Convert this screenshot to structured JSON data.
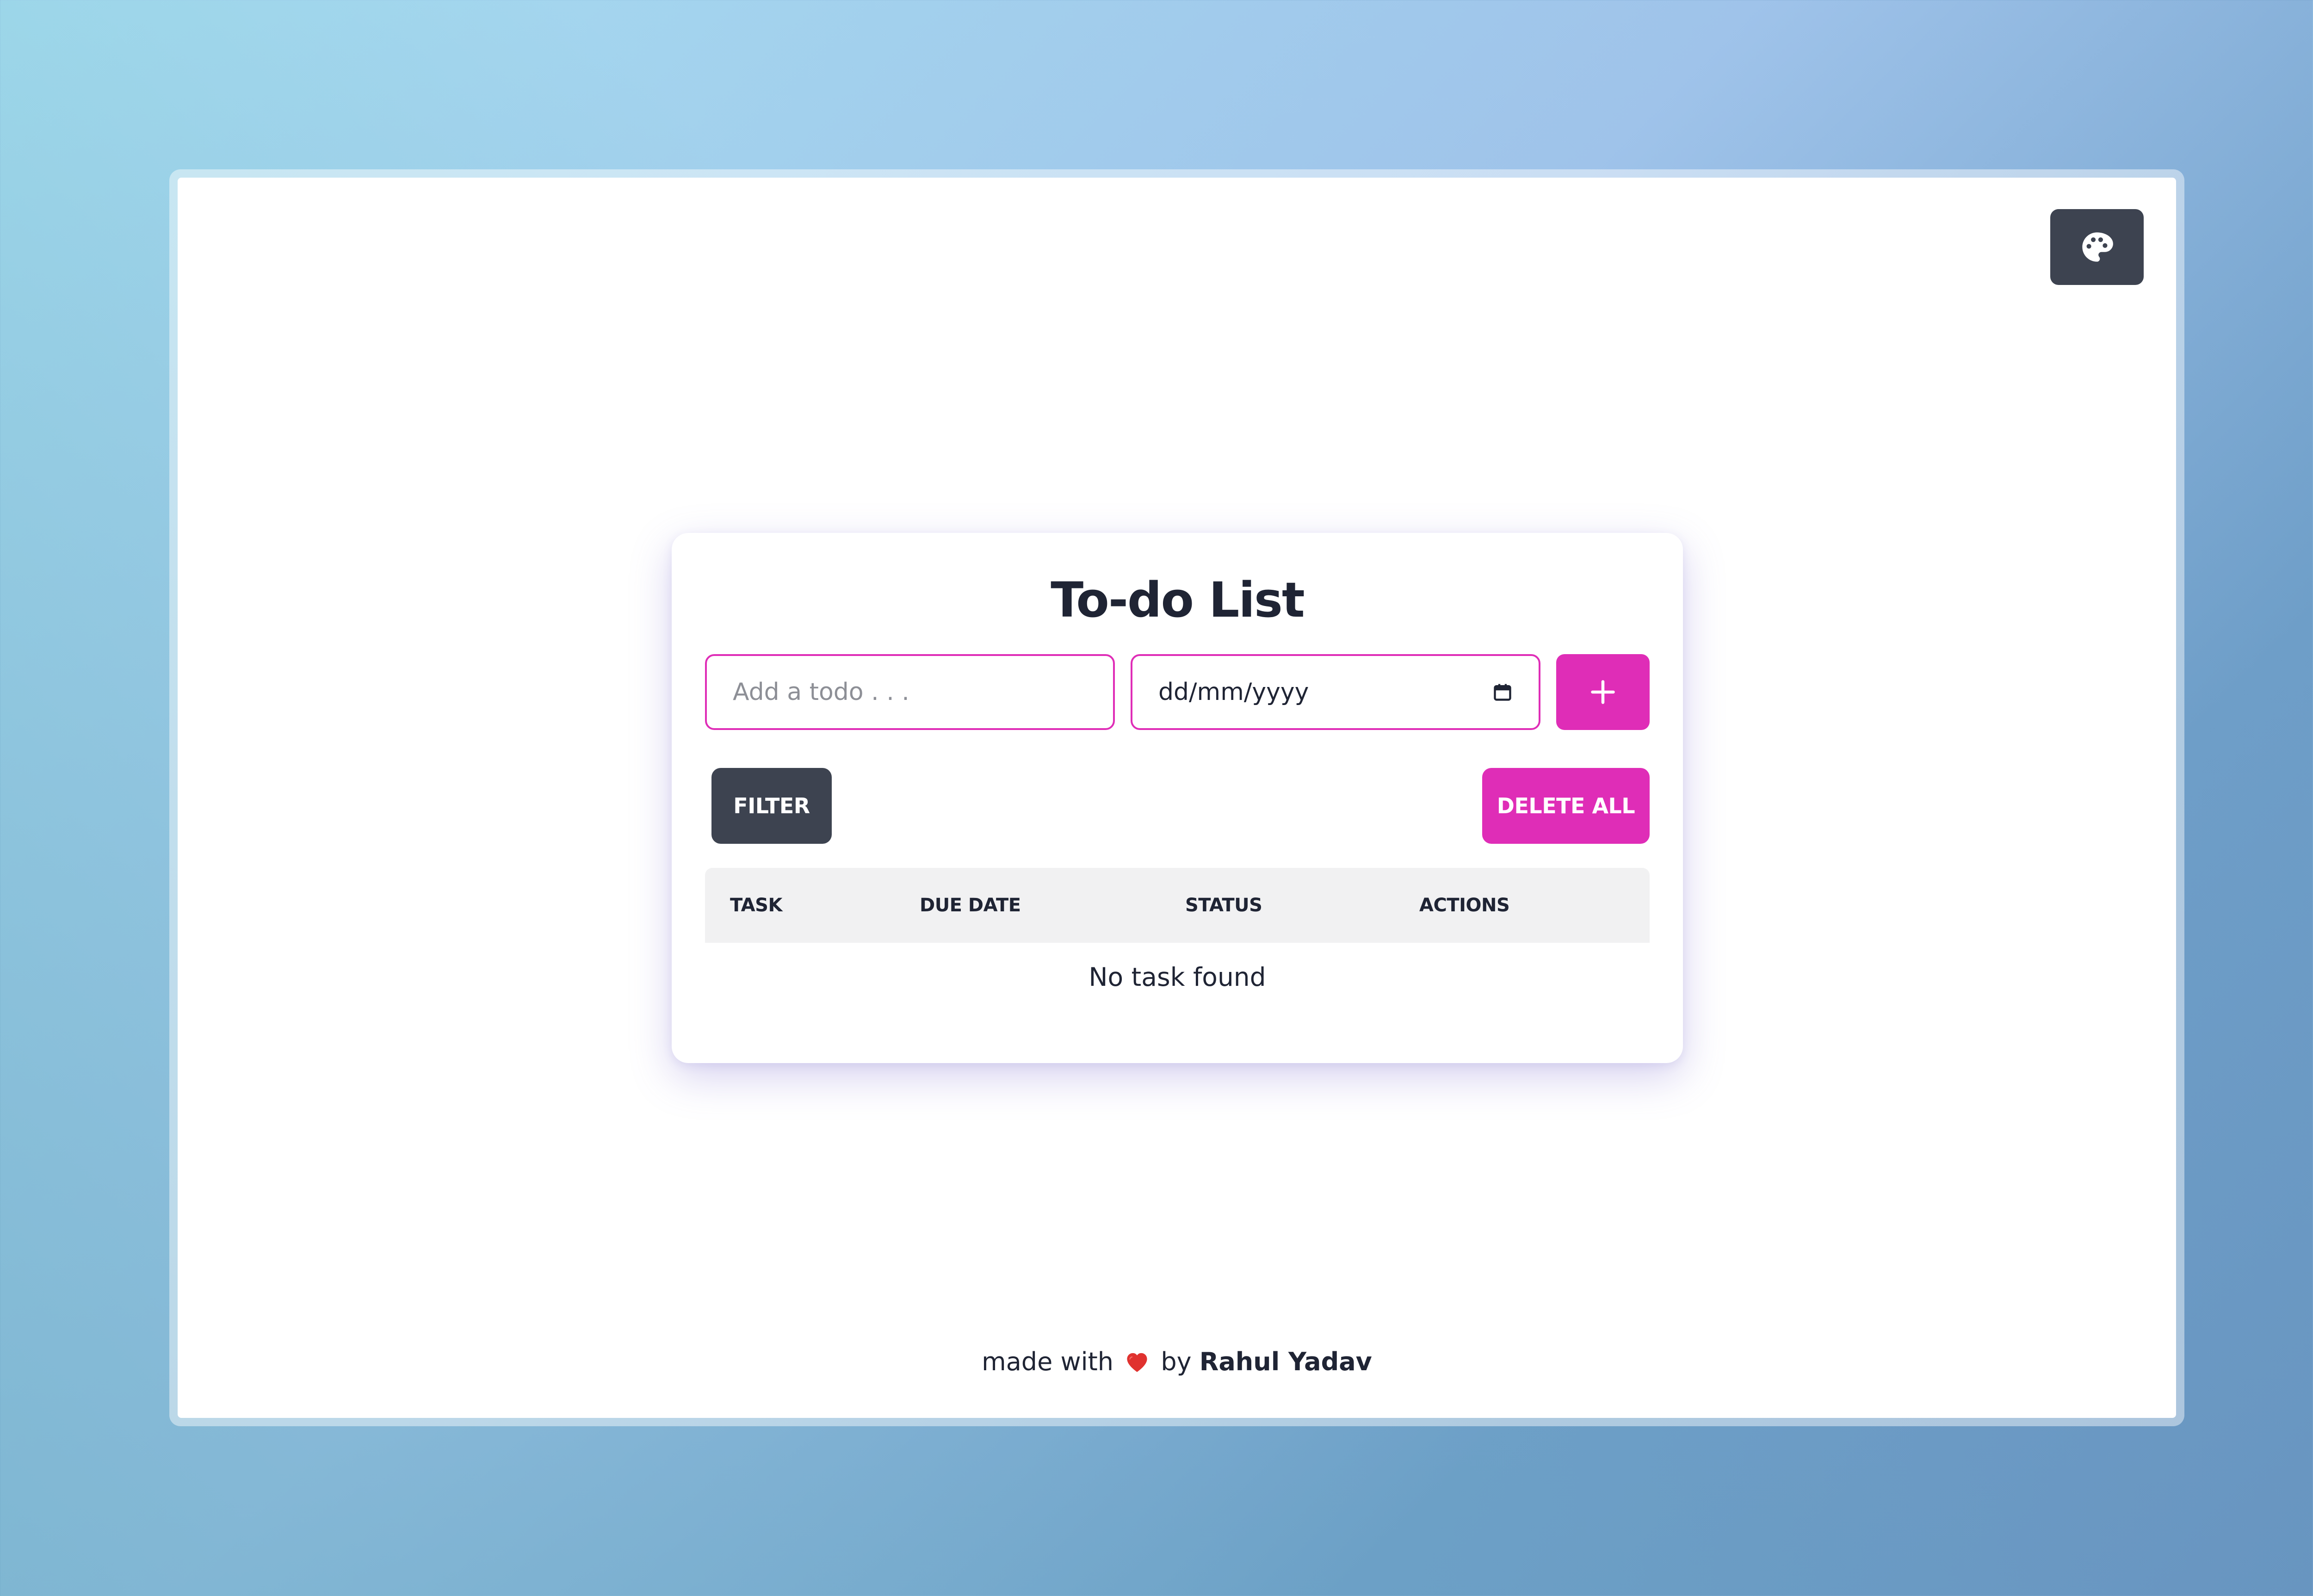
{
  "app": {
    "title": "To-do List"
  },
  "colors": {
    "accent": "#df2db7",
    "dark_button": "#3d4350",
    "text": "#1f2434",
    "table_header_bg": "#f1f1f2"
  },
  "toolbar": {
    "theme_icon": "palette-icon"
  },
  "form": {
    "todo_placeholder": "Add a todo . . .",
    "todo_value": "",
    "date_placeholder": "dd/mm/yyyy",
    "date_icon": "calendar-icon",
    "add_icon": "plus-icon"
  },
  "actions": {
    "filter_label": "FILTER",
    "delete_all_label": "DELETE ALL"
  },
  "table": {
    "columns": [
      "TASK",
      "DUE DATE",
      "STATUS",
      "ACTIONS"
    ],
    "rows": [],
    "empty_message": "No task found"
  },
  "footer": {
    "prefix": "made with",
    "heart_icon": "heart-icon",
    "by": "by",
    "author": "Rahul Yadav"
  }
}
